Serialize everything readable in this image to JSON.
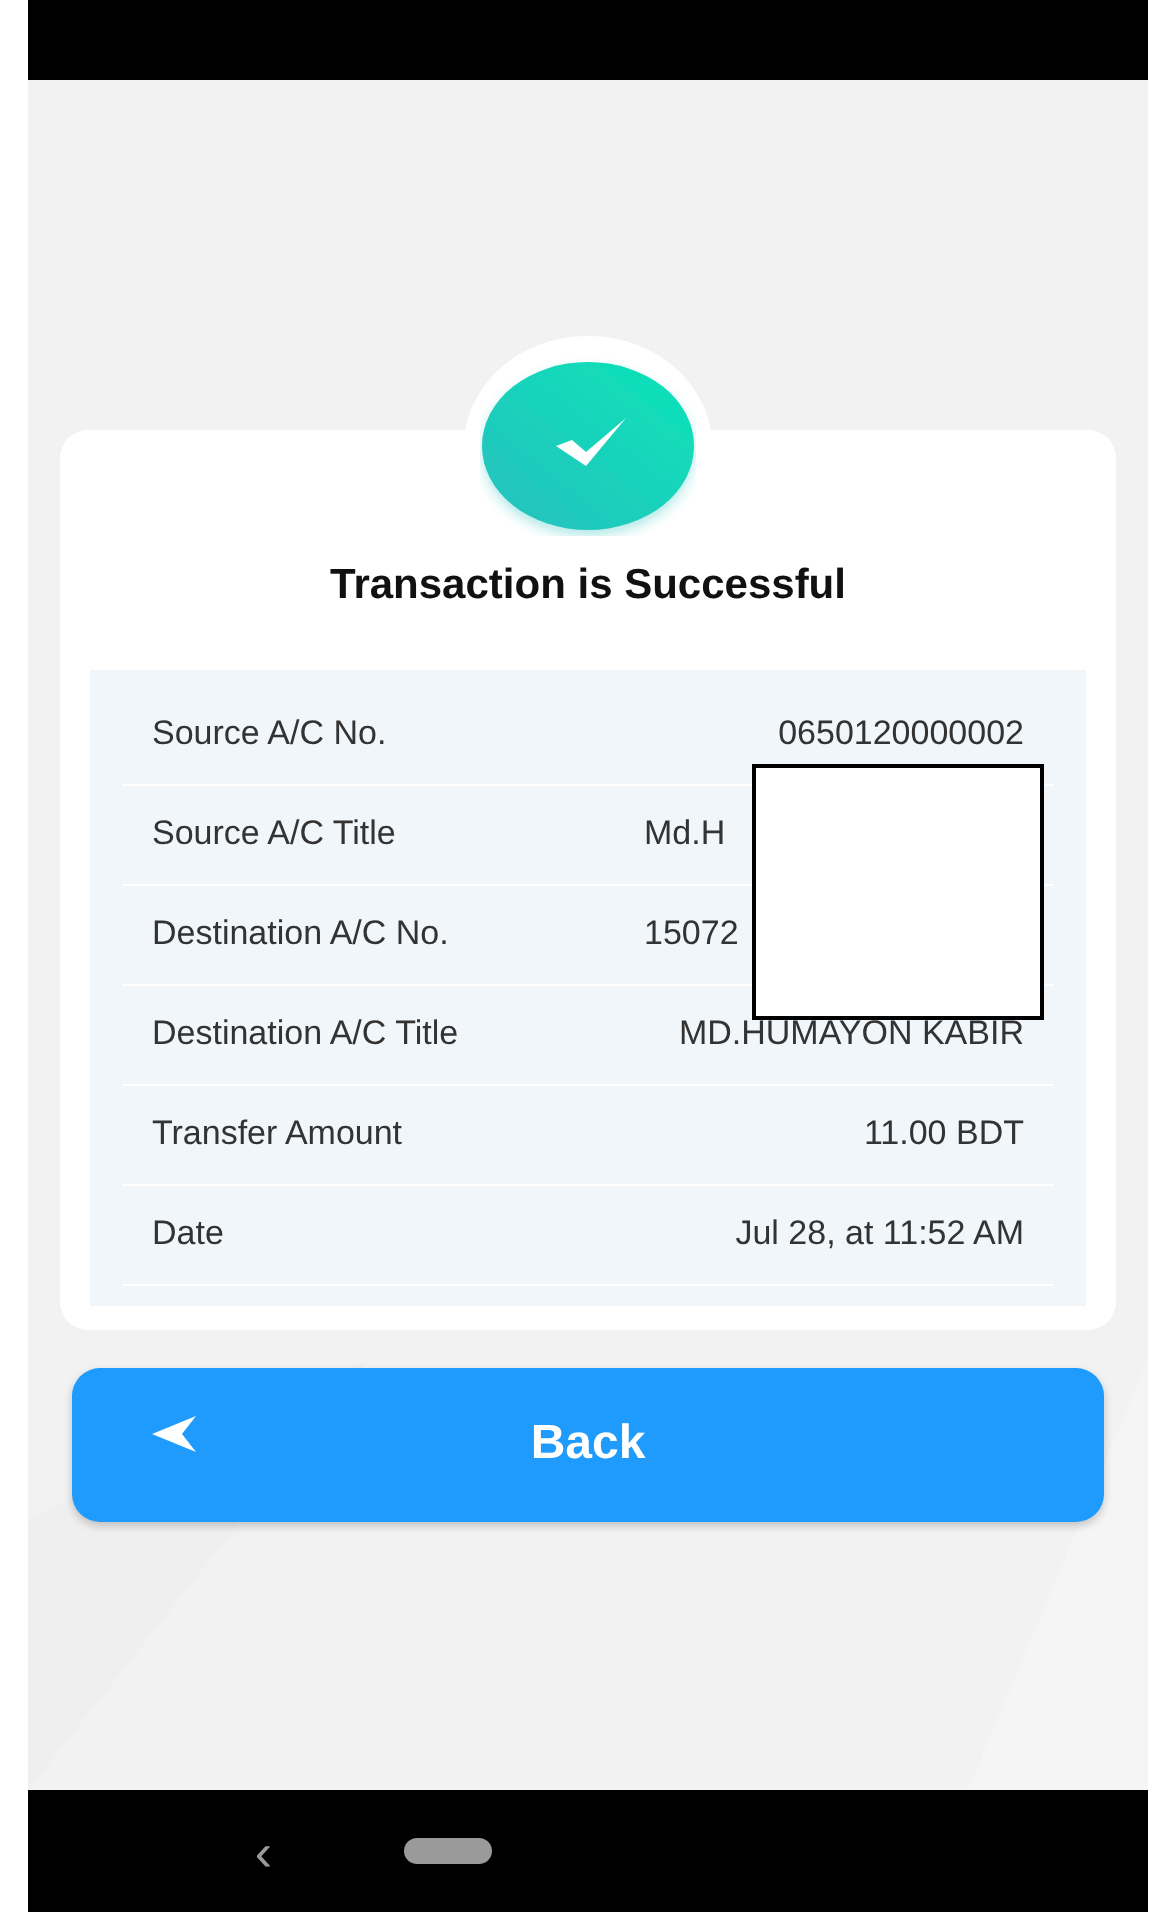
{
  "title": "Transaction is Successful",
  "details": [
    {
      "label": "Source A/C No.",
      "value": "0650120000002",
      "redacted": false
    },
    {
      "label": "Source A/C Title",
      "value": "Md.H",
      "redacted": true
    },
    {
      "label": "Destination A/C No.",
      "value": "15072",
      "redacted": true
    },
    {
      "label": "Destination A/C Title",
      "value": "MD.HUMAYON KABIR",
      "redacted": false
    },
    {
      "label": "Transfer Amount",
      "value": "11.00 BDT",
      "redacted": false
    },
    {
      "label": "Date",
      "value": "Jul 28, at 11:52 AM",
      "redacted": false
    }
  ],
  "back_button": {
    "label": "Back"
  },
  "nav_bar": {
    "back": "‹"
  }
}
